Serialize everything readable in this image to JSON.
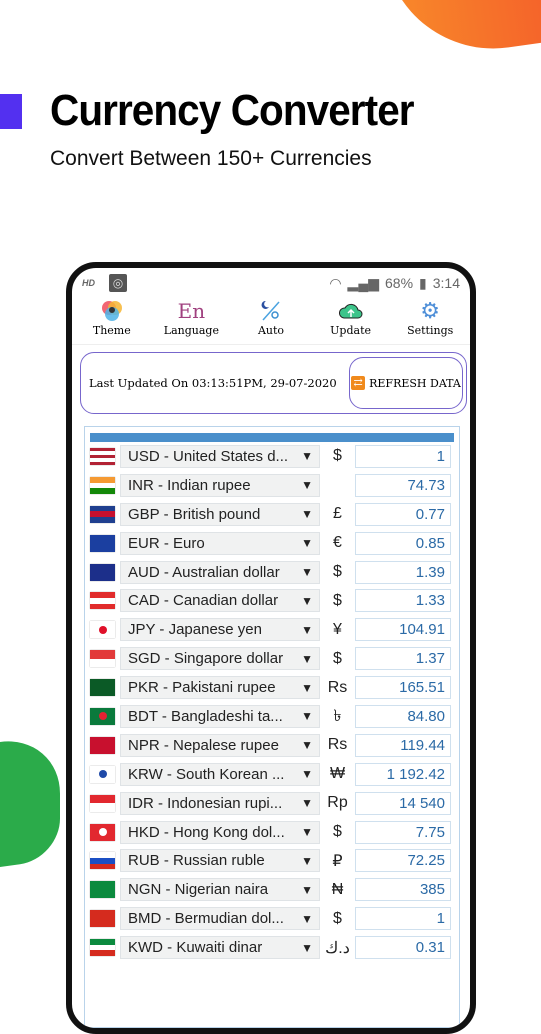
{
  "promo": {
    "title": "Currency Converter",
    "subtitle": "Convert Between 150+ Currencies"
  },
  "status": {
    "hd": "HD",
    "battery": "68%",
    "time": "3:14"
  },
  "toolbar": [
    {
      "label": "Theme",
      "icon": "theme-icon"
    },
    {
      "label": "Language",
      "icon": "language-icon",
      "glyph": "En"
    },
    {
      "label": "Auto",
      "icon": "auto-theme-icon"
    },
    {
      "label": "Update",
      "icon": "cloud-upload-icon"
    },
    {
      "label": "Settings",
      "icon": "gear-icon"
    }
  ],
  "info": {
    "last_updated": "Last Updated On 03:13:51PM, 29-07-2020",
    "refresh_label": "REFRESH DATA"
  },
  "colors": {
    "accent": "#4a8fcb",
    "value_text": "#2b6aa6",
    "card_border": "#7766cc"
  },
  "currencies": [
    {
      "name": "USD - United States d...",
      "symbol": "$",
      "value": "1",
      "flag": [
        "#b22234",
        "#fff",
        "#b22234",
        "#fff",
        "#b22234"
      ],
      "emb": ""
    },
    {
      "name": "INR - Indian rupee",
      "symbol": "",
      "value": "74.73",
      "flag": [
        "#f59a33",
        "#fff",
        "#138808"
      ],
      "emb": ""
    },
    {
      "name": "GBP - British pound",
      "symbol": "£",
      "value": "0.77",
      "flag": [
        "#1f3f8f",
        "#c8102e",
        "#1f3f8f"
      ],
      "emb": ""
    },
    {
      "name": "EUR - Euro",
      "symbol": "€",
      "value": "0.85",
      "flag": [
        "#1b3fa0"
      ],
      "emb": ""
    },
    {
      "name": "AUD - Australian dollar",
      "symbol": "$",
      "value": "1.39",
      "flag": [
        "#1c2f8a"
      ],
      "emb": ""
    },
    {
      "name": "CAD - Canadian dollar",
      "symbol": "$",
      "value": "1.33",
      "flag": [
        "#e12b2b",
        "#fff",
        "#e12b2b"
      ],
      "emb": ""
    },
    {
      "name": "JPY - Japanese yen",
      "symbol": "¥",
      "value": "104.91",
      "flag": [
        "#fff"
      ],
      "emb": "#e0102a"
    },
    {
      "name": "SGD - Singapore dollar",
      "symbol": "$",
      "value": "1.37",
      "flag": [
        "#e23a3a",
        "#fff"
      ],
      "emb": ""
    },
    {
      "name": "PKR - Pakistani rupee",
      "symbol": "Rs",
      "value": "165.51",
      "flag": [
        "#0b5a26"
      ],
      "emb": ""
    },
    {
      "name": "BDT - Bangladeshi ta...",
      "symbol": "৳",
      "value": "84.80",
      "flag": [
        "#0a7a3c"
      ],
      "emb": "#e42232"
    },
    {
      "name": "NPR - Nepalese rupee",
      "symbol": "Rs",
      "value": "119.44",
      "flag": [
        "#c8102e"
      ],
      "emb": ""
    },
    {
      "name": "KRW - South Korean ...",
      "symbol": "₩",
      "value": "1 192.42",
      "flag": [
        "#fff"
      ],
      "emb": "#1f4aa8"
    },
    {
      "name": "IDR - Indonesian rupi...",
      "symbol": "Rp",
      "value": "14 540",
      "flag": [
        "#e2282f",
        "#fff"
      ],
      "emb": ""
    },
    {
      "name": "HKD - Hong Kong dol...",
      "symbol": "$",
      "value": "7.75",
      "flag": [
        "#e2282f"
      ],
      "emb": "#fff"
    },
    {
      "name": "RUB - Russian ruble",
      "symbol": "₽",
      "value": "72.25",
      "flag": [
        "#fff",
        "#1b4fc4",
        "#d52b1e"
      ],
      "emb": ""
    },
    {
      "name": "NGN - Nigerian naira",
      "symbol": "₦",
      "value": "385",
      "flag": [
        "#0b8a3e"
      ],
      "emb": ""
    },
    {
      "name": "BMD - Bermudian dol...",
      "symbol": "$",
      "value": "1",
      "flag": [
        "#d52b1e"
      ],
      "emb": ""
    },
    {
      "name": "KWD - Kuwaiti dinar",
      "symbol": "د.ك",
      "value": "0.31",
      "flag": [
        "#0b8a3e",
        "#fff",
        "#d52b1e"
      ],
      "emb": ""
    }
  ]
}
